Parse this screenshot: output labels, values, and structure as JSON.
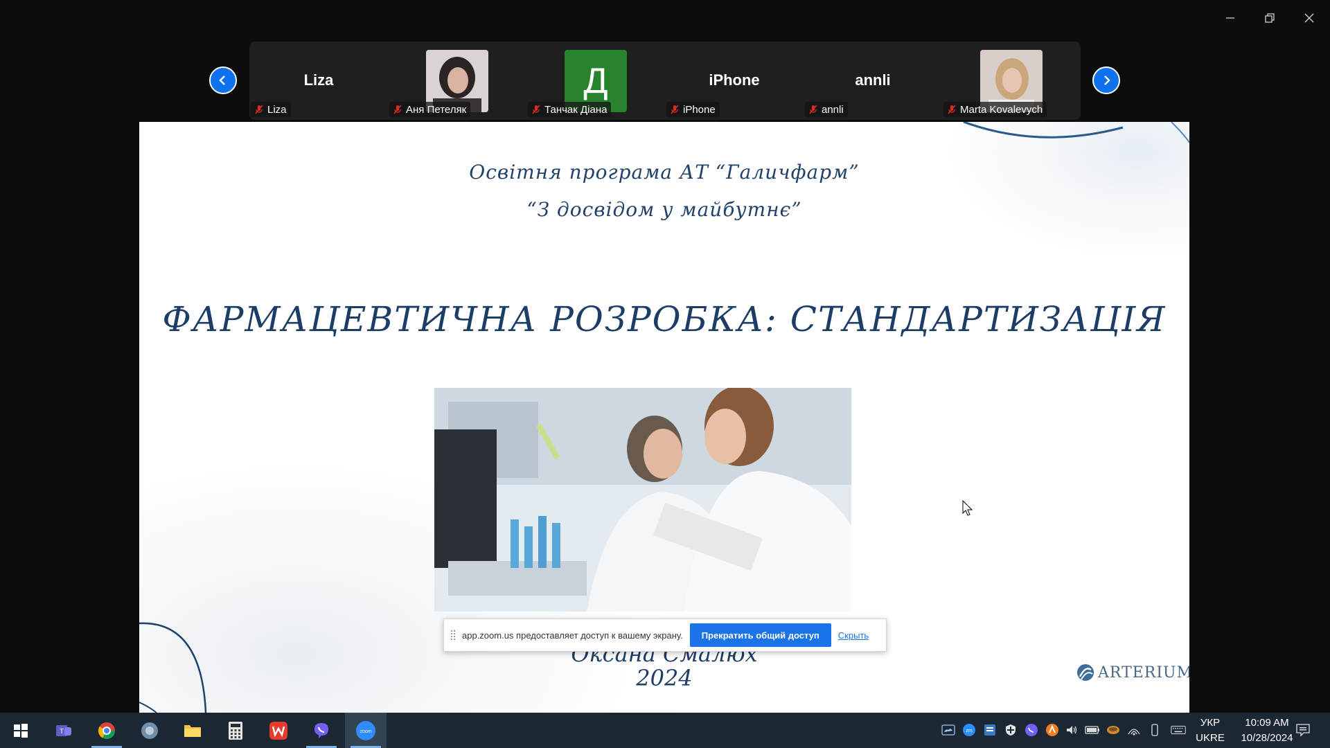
{
  "participants": [
    {
      "display": "Liza",
      "name": "Liza",
      "type": "text"
    },
    {
      "display": "",
      "name": "Аня Петеляк",
      "type": "photo"
    },
    {
      "display": "Д",
      "name": "Танчак Діана",
      "type": "letter"
    },
    {
      "display": "iPhone",
      "name": "iPhone",
      "type": "text"
    },
    {
      "display": "annli",
      "name": "annli",
      "type": "text"
    },
    {
      "display": "",
      "name": "Marta Kovalevych",
      "type": "photo"
    }
  ],
  "slide": {
    "subtitle1": "Освітня програма АТ “Галичфарм”",
    "subtitle2": "“З досвідом у майбутнє”",
    "title": "ФАРМАЦЕВТИЧНА РОЗРОБКА: СТАНДАРТИЗАЦІЯ",
    "author": "Оксана Смалюх",
    "year": "2024",
    "logo": "ARTERIUM"
  },
  "share_bar": {
    "message": "app.zoom.us предоставляет доступ к вашему экрану.",
    "stop_label": "Прекратить общий доступ",
    "hide_label": "Скрыть"
  },
  "taskbar": {
    "apps": [
      "windows-start",
      "teams",
      "chrome",
      "settings-app",
      "file-explorer",
      "calculator",
      "wps-office",
      "viber",
      "zoom"
    ],
    "active_app": "zoom",
    "lang_top": "УКР",
    "lang_bottom": "UKRE",
    "time": "10:09 AM",
    "date": "10/28/2024"
  },
  "colors": {
    "accent": "#0e72ed",
    "slide_text": "#1c3d66",
    "mute_red": "#e02828",
    "taskbar": "#1b2834"
  }
}
